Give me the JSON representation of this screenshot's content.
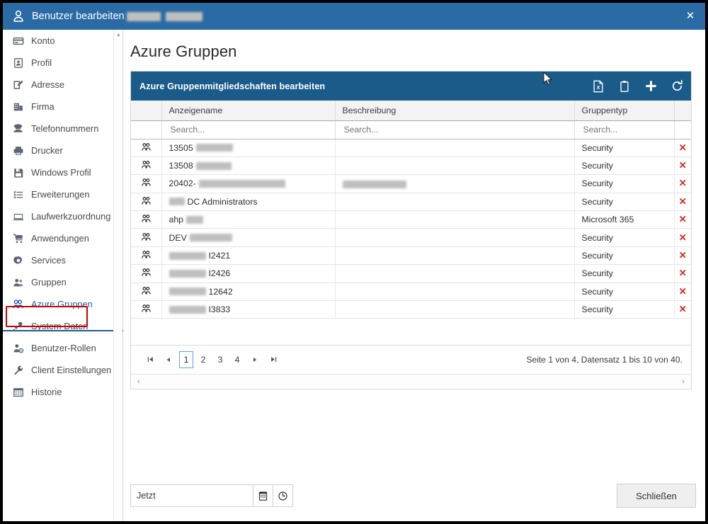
{
  "titlebar": {
    "icon": "user-icon",
    "title": "Benutzer bearbeiten",
    "redacted_name": true,
    "close_label": "✕",
    "bg_color": "#2a6ba5"
  },
  "sidebar": {
    "items": [
      {
        "label": "Konto",
        "icon": "card-icon",
        "active": false
      },
      {
        "label": "Profil",
        "icon": "id-badge-icon",
        "active": false
      },
      {
        "label": "Adresse",
        "icon": "edit-square-icon",
        "active": false
      },
      {
        "label": "Firma",
        "icon": "building-icon",
        "active": false
      },
      {
        "label": "Telefonnummern",
        "icon": "phone-icon",
        "active": false
      },
      {
        "label": "Drucker",
        "icon": "printer-icon",
        "active": false
      },
      {
        "label": "Windows Profil",
        "icon": "floppy-icon",
        "active": false
      },
      {
        "label": "Erweiterungen",
        "icon": "list-icon",
        "active": false
      },
      {
        "label": "Laufwerkzuordnung",
        "icon": "monitor-icon",
        "active": false
      },
      {
        "label": "Anwendungen",
        "icon": "cart-icon",
        "active": false
      },
      {
        "label": "Services",
        "icon": "gear-icon",
        "active": false
      },
      {
        "label": "Gruppen",
        "icon": "people-icon",
        "active": false
      },
      {
        "label": "Azure Gruppen",
        "icon": "group-icon",
        "active": true
      },
      {
        "label": "System Daten",
        "icon": "node-icon",
        "active": false
      },
      {
        "label": "Benutzer-Rollen",
        "icon": "person-key-icon",
        "active": false
      },
      {
        "label": "Client Einstellungen",
        "icon": "wrench-icon",
        "active": false
      },
      {
        "label": "Historie",
        "icon": "calendar-icon",
        "active": false
      }
    ],
    "annotation_color": "#cc0000",
    "divider_color": "#1f5c9c"
  },
  "main": {
    "page_title": "Azure Gruppen",
    "panel": {
      "header_title": "Azure Gruppenmitgliedschaften bearbeiten",
      "header_bg": "#1b5b8a",
      "tools": [
        {
          "name": "export-excel-icon",
          "label": "Excel Export"
        },
        {
          "name": "clipboard-icon",
          "label": "Kopieren"
        },
        {
          "name": "plus-icon",
          "label": "Hinzufügen"
        },
        {
          "name": "refresh-icon",
          "label": "Aktualisieren"
        }
      ],
      "table": {
        "columns": [
          "",
          "Anzeigename",
          "Beschreibung",
          "Gruppentyp",
          ""
        ],
        "filters": [
          {
            "placeholder": "Search...",
            "value": ""
          },
          {
            "placeholder": "Search...",
            "value": ""
          },
          {
            "placeholder": "Search...",
            "value": ""
          }
        ],
        "rows": [
          {
            "icon": "group-icon",
            "name_prefix": "13505",
            "name_redacted": true,
            "redact_w": 52,
            "desc": "",
            "desc_redacted": false,
            "desc_redact_w": 0,
            "type": "Security",
            "delete": "✕"
          },
          {
            "icon": "group-icon",
            "name_prefix": "13508",
            "name_redacted": true,
            "redact_w": 50,
            "desc": "",
            "desc_redacted": false,
            "desc_redact_w": 0,
            "type": "Security",
            "delete": "✕"
          },
          {
            "icon": "group-icon",
            "name_prefix": "20402-",
            "name_redacted": true,
            "redact_w": 122,
            "desc": "",
            "desc_redacted": true,
            "desc_redact_w": 90,
            "type": "Security",
            "delete": "✕"
          },
          {
            "icon": "group-icon",
            "name_prefix": "",
            "name_redacted_lead": 22,
            "name_suffix": "DC Administrators",
            "desc": "",
            "desc_redacted": false,
            "desc_redact_w": 0,
            "type": "Security",
            "delete": "✕"
          },
          {
            "icon": "group-icon",
            "name_prefix": "ahp",
            "name_redacted": true,
            "redact_w": 24,
            "desc": "",
            "desc_redacted": false,
            "desc_redact_w": 0,
            "type": "Microsoft 365",
            "delete": "✕"
          },
          {
            "icon": "group-icon",
            "name_prefix": "DEV",
            "name_redacted": true,
            "redact_w": 60,
            "desc": "",
            "desc_redacted": false,
            "desc_redact_w": 0,
            "type": "Security",
            "delete": "✕"
          },
          {
            "icon": "group-icon",
            "name_prefix": "",
            "name_redacted_lead": 52,
            "name_suffix": "I2421",
            "desc": "",
            "desc_redacted": false,
            "desc_redact_w": 0,
            "type": "Security",
            "delete": "✕"
          },
          {
            "icon": "group-icon",
            "name_prefix": "",
            "name_redacted_lead": 52,
            "name_suffix": "I2426",
            "desc": "",
            "desc_redacted": false,
            "desc_redact_w": 0,
            "type": "Security",
            "delete": "✕"
          },
          {
            "icon": "group-icon",
            "name_prefix": "",
            "name_redacted_lead": 52,
            "name_suffix": "12642",
            "desc": "",
            "desc_redacted": false,
            "desc_redact_w": 0,
            "type": "Security",
            "delete": "✕"
          },
          {
            "icon": "group-icon",
            "name_prefix": "",
            "name_redacted_lead": 52,
            "name_suffix": "I3833",
            "desc": "",
            "desc_redacted": false,
            "desc_redact_w": 0,
            "type": "Security",
            "delete": "✕"
          }
        ]
      },
      "pager": {
        "first": "⏮",
        "prev": "◀",
        "next": "▶",
        "last": "⏭",
        "pages": [
          "1",
          "2",
          "3",
          "4"
        ],
        "current_page": "1",
        "status": "Seite 1 von 4, Datensatz 1 bis 10 von 40.",
        "scroll_left": "‹",
        "scroll_right": "›"
      }
    },
    "footer": {
      "datetime_value": "Jetzt",
      "calendar_icon": "calendar-icon",
      "clock_icon": "clock-icon",
      "close_button": "Schließen"
    }
  }
}
